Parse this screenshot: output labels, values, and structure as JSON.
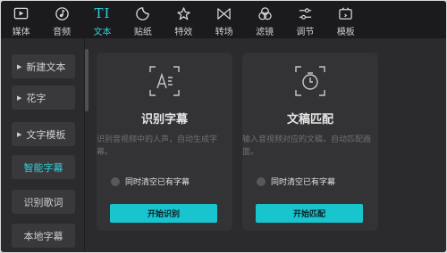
{
  "toolbar": {
    "tabs": [
      {
        "label": "媒体",
        "icon": "media-icon"
      },
      {
        "label": "音频",
        "icon": "audio-icon"
      },
      {
        "label": "文本",
        "icon": "text-icon",
        "active": true
      },
      {
        "label": "贴纸",
        "icon": "sticker-icon"
      },
      {
        "label": "特效",
        "icon": "effects-icon"
      },
      {
        "label": "转场",
        "icon": "transition-icon"
      },
      {
        "label": "滤镜",
        "icon": "filter-icon"
      },
      {
        "label": "调节",
        "icon": "adjust-icon"
      },
      {
        "label": "模板",
        "icon": "template-icon"
      }
    ],
    "text_glyph": "TI"
  },
  "sidebar": {
    "items": [
      {
        "label": "新建文本",
        "caret": "▶"
      },
      {
        "label": "花字",
        "caret": "▶"
      },
      {
        "label": "文字模板",
        "caret": "▶"
      },
      {
        "label": "智能字幕",
        "active": true
      },
      {
        "label": "识别歌词"
      },
      {
        "label": "本地字幕"
      }
    ]
  },
  "cards": [
    {
      "title": "识别字幕",
      "description": "识别音视频中的人声，自动生成字幕。",
      "checkbox_label": "同时清空已有字幕",
      "button_label": "开始识别",
      "icon": "speech-text-icon"
    },
    {
      "title": "文稿匹配",
      "description": "输入音视频对应的文稿，自动匹配画面。",
      "checkbox_label": "同时清空已有字幕",
      "button_label": "开始匹配",
      "icon": "timer-match-icon"
    }
  ],
  "colors": {
    "accent": "#2fd1d9",
    "button": "#18c5cf",
    "background": "#2b2b2e",
    "toolbar_bg": "#1b1b1d",
    "card_bg": "#333336"
  }
}
